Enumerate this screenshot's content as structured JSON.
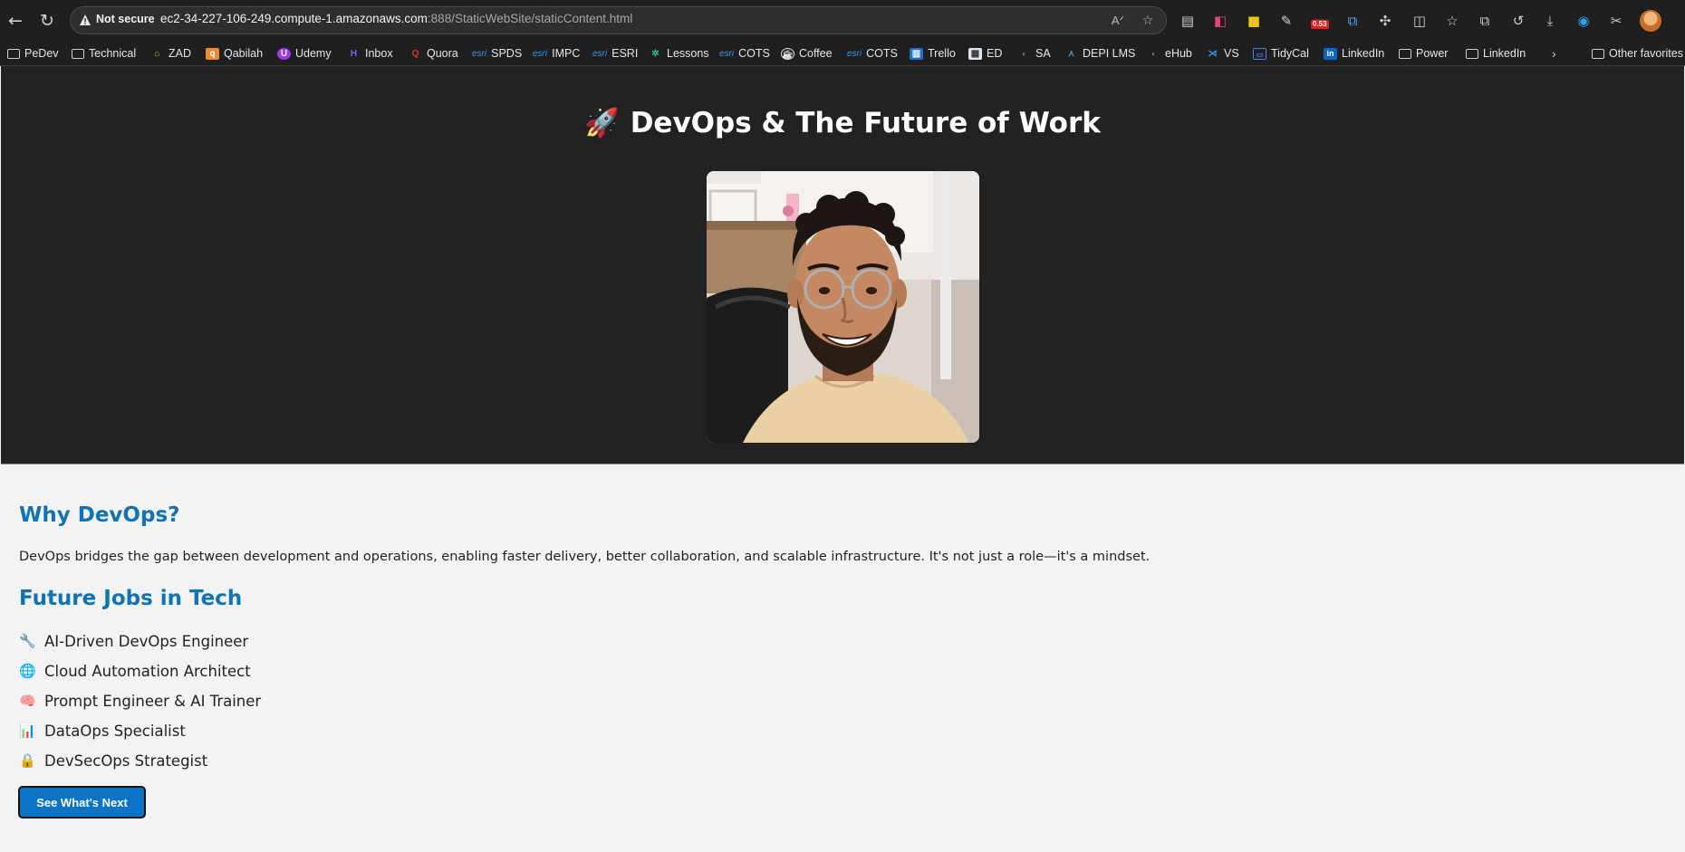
{
  "browser": {
    "security_label": "Not secure",
    "url_host": "ec2-34-227-106-249.compute-1.amazonaws.com",
    "url_rest": ":888/StaticWebSite/staticContent.html",
    "badge_count": "0.53",
    "bookmarks": [
      {
        "label": "PeDev",
        "icon": "folder-icon"
      },
      {
        "label": "Technical",
        "icon": "folder-icon"
      },
      {
        "label": "ZAD",
        "icon": "zad-icon"
      },
      {
        "label": "Qabilah",
        "icon": "qabilah-icon"
      },
      {
        "label": "Udemy",
        "icon": "udemy-icon"
      },
      {
        "label": "Inbox",
        "icon": "inbox-icon"
      },
      {
        "label": "Quora",
        "icon": "quora-icon"
      },
      {
        "label": "SPDS",
        "icon": "esri-icon"
      },
      {
        "label": "IMPC",
        "icon": "esri-icon"
      },
      {
        "label": "ESRI",
        "icon": "esri-icon"
      },
      {
        "label": "Lessons",
        "icon": "lessons-icon"
      },
      {
        "label": "COTS",
        "icon": "esri-icon"
      },
      {
        "label": "Coffee",
        "icon": "coffee-icon"
      },
      {
        "label": "COTS",
        "icon": "esri-icon"
      },
      {
        "label": "Trello",
        "icon": "trello-icon"
      },
      {
        "label": "ED",
        "icon": "ed-icon"
      },
      {
        "label": "SA",
        "icon": "sa-icon"
      },
      {
        "label": "DEPI LMS",
        "icon": "depi-icon"
      },
      {
        "label": "eHub",
        "icon": "ehub-icon"
      },
      {
        "label": "VS",
        "icon": "vscode-icon"
      },
      {
        "label": "TidyCal",
        "icon": "tidycal-icon"
      },
      {
        "label": "LinkedIn",
        "icon": "linkedin-icon"
      },
      {
        "label": "Power",
        "icon": "folder-icon"
      },
      {
        "label": "LinkedIn",
        "icon": "folder-icon"
      }
    ],
    "other_favorites": "Other favorites",
    "esri_mark": "esri"
  },
  "hero": {
    "rocket": "🚀",
    "title": "DevOps & The Future of Work"
  },
  "why": {
    "heading": "Why DevOps?",
    "body": "DevOps bridges the gap between development and operations, enabling faster delivery, better collaboration, and scalable infrastructure. It's not just a role—it's a mindset."
  },
  "future": {
    "heading": "Future Jobs in Tech",
    "jobs": [
      {
        "icon": "🔧",
        "label": "AI-Driven DevOps Engineer"
      },
      {
        "icon": "🌐",
        "label": "Cloud Automation Architect"
      },
      {
        "icon": "🧠",
        "label": "Prompt Engineer & AI Trainer"
      },
      {
        "icon": "📊",
        "label": "DataOps Specialist"
      },
      {
        "icon": "🔒",
        "label": "DevSecOps Strategist"
      }
    ]
  },
  "cta": {
    "label": "See What's Next"
  },
  "colors": {
    "accent": "#0f73b5",
    "button": "#0c74c6",
    "hero_bg": "#222222",
    "page_bg": "#f3f3f3"
  }
}
